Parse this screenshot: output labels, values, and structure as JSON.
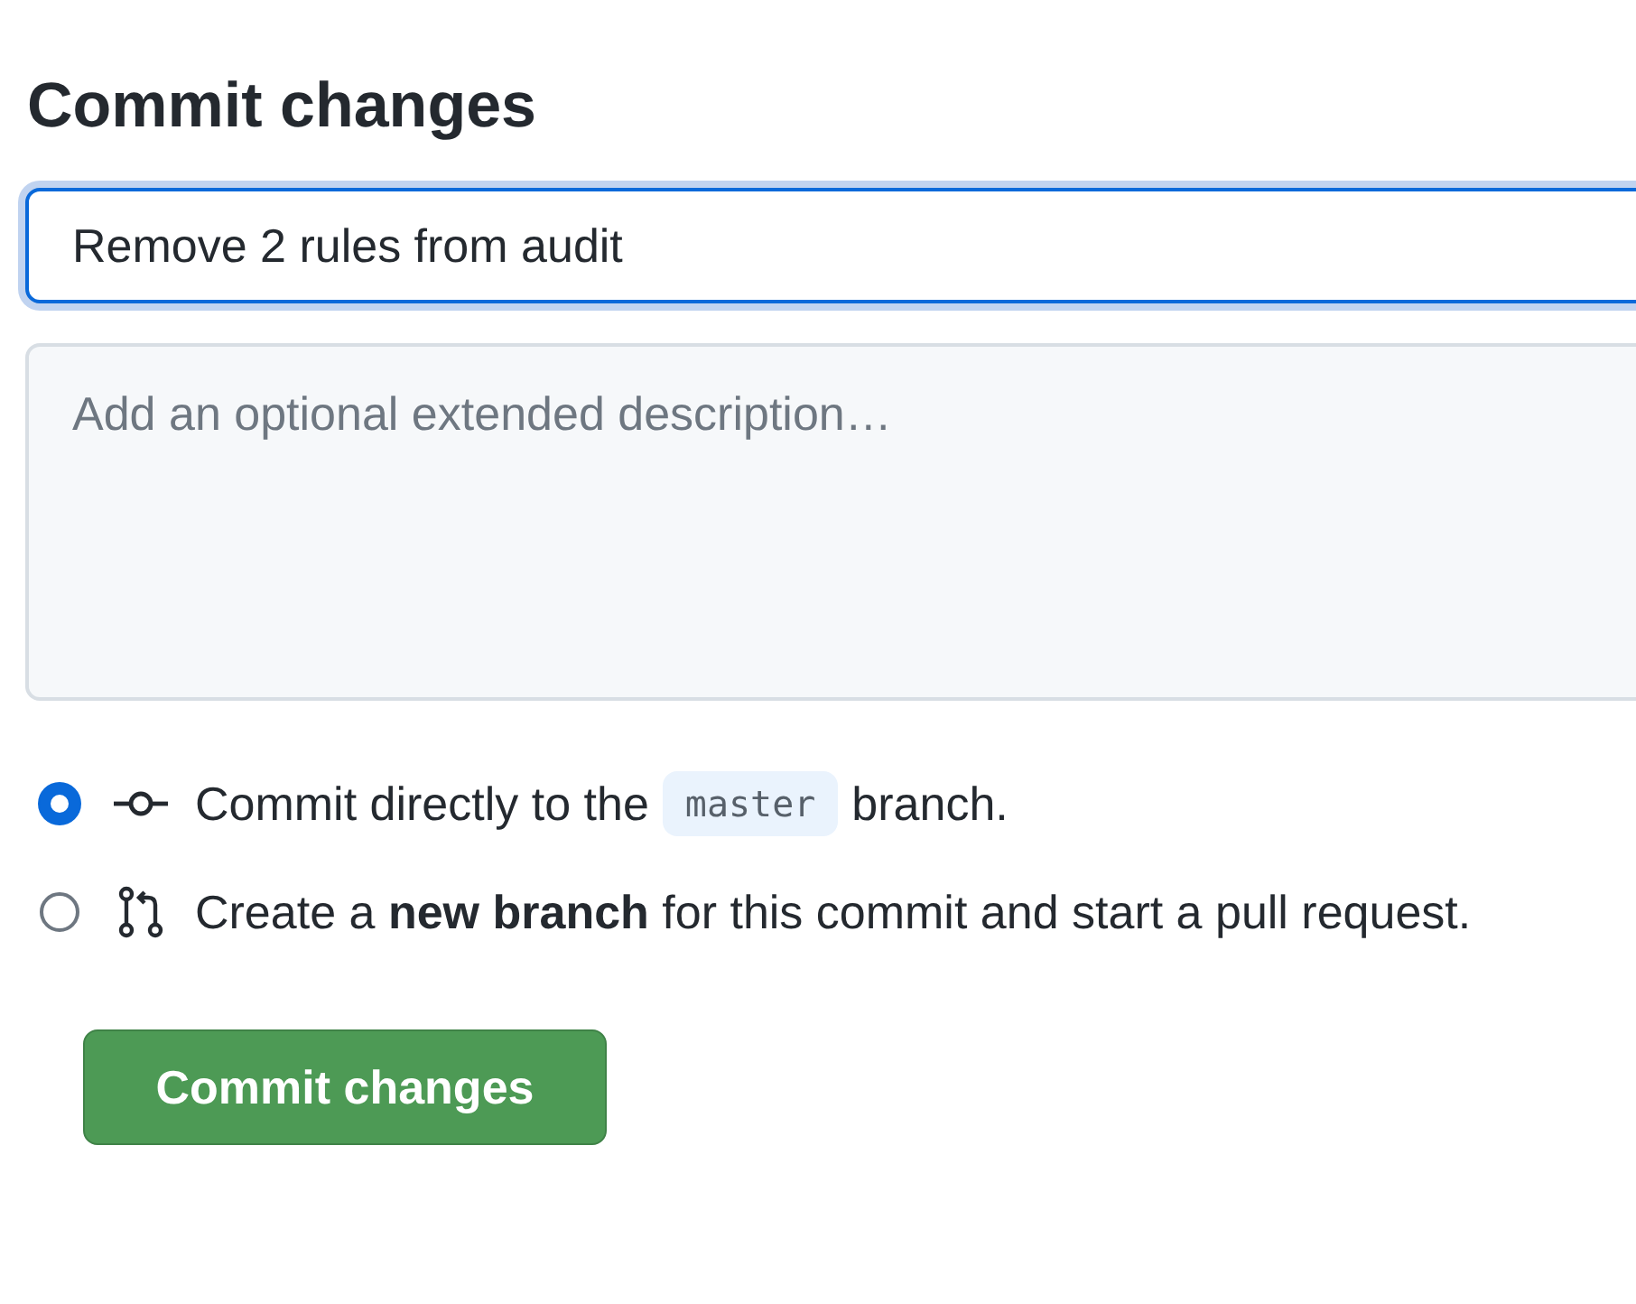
{
  "title": "Commit changes",
  "summary": {
    "value": "Remove 2 rules from audit"
  },
  "description": {
    "placeholder": "Add an optional extended description…"
  },
  "options": [
    {
      "kind": "direct",
      "selected": true,
      "label": "Commit directly to the",
      "branch": "master",
      "label_after": "branch."
    },
    {
      "kind": "new-branch",
      "selected": false,
      "label": "Create a **new branch** for this commit and start a pull request."
    }
  ],
  "button": "Commit changes"
}
